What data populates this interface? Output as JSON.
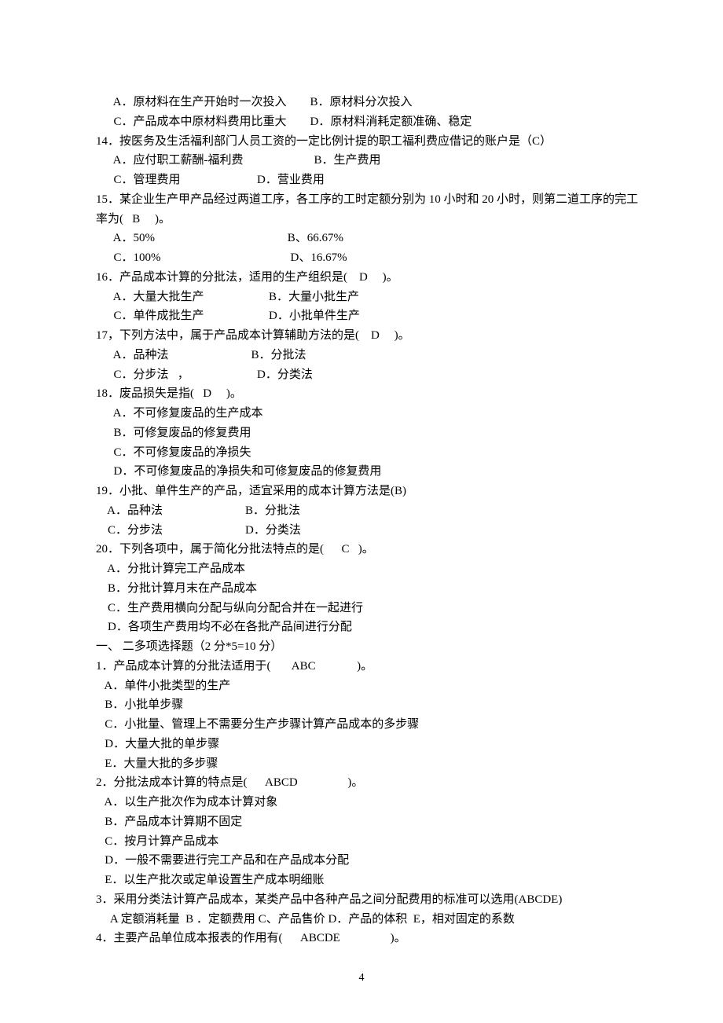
{
  "lines": [
    "      A．原材料在生产开始时一次投入        B．原材料分次投入",
    "      C．产品成本中原材料费用比重大        D．原材料消耗定额准确、稳定",
    "14．按医务及生活福利部门人员工资的一定比例计提的职工福利费应借记的账户是（C）",
    "      A．应付职工薪酬-福利费                        B．生产费用",
    "      C．管理费用                          D．营业费用",
    "15．某企业生产甲产品经过两道工序，各工序的工时定额分别为 10 小时和 20 小时，则第二道工序的完工",
    "率为(   B     )。",
    "      A．50%                                             B、66.67%",
    "      C．100%                                            D、16.67%",
    "16．产品成本计算的分批法，适用的生产组织是(    D     )。",
    "      A．大量大批生产                      B．大量小批生产",
    "      C．单件成批生产                      D．小批单件生产",
    "17，下列方法中，属于产品成本计算辅助方法的是(    D     )。",
    "      A．品种法                            B．分批法",
    "      C．分步法   ，                       D．分类法",
    "18．废品损失是指(   D     )。",
    "      A．不可修复废品的生产成本",
    "      B．可修复废品的修复费用",
    "      C．不可修复废品的净损失",
    "      D．不可修复废品的净损失和可修复废品的修复费用",
    "19．小批、单件生产的产品，适宜采用的成本计算方法是(B)",
    "    A．品种法                            B．分批法",
    "    C．分步法                            D．分类法",
    "20．下列各项中，属于简化分批法特点的是(      C   )。",
    "    A．分批计算完工产品成本",
    "    B．分批计算月末在产品成本",
    "    C．生产费用横向分配与纵向分配合并在一起进行",
    "    D．各项生产费用均不必在各批产品间进行分配",
    "一、 二多项选择题（2 分*5=10 分）",
    "1．产品成本计算的分批法适用于(       ABC              )。",
    "   A．单件小批类型的生产",
    "   B．小批单步骤",
    "   C．小批量、管理上不需要分生产步骤计算产品成本的多步骤",
    "   D．大量大批的单步骤",
    "   E．大量大批的多步骤",
    "2．分批法成本计算的特点是(      ABCD                 )。",
    "   A．以生产批次作为成本计算对象",
    "   B．产品成本计算期不固定",
    "   C．按月计算产品成本",
    "   D．一般不需要进行完工产品和在产品成本分配",
    "   E．以生产批次或定单设置生产成本明细账",
    "3．采用分类法计算产品成本，某类产品中各种产品之间分配费用的标准可以选用(ABCDE)",
    "     A 定额消耗量  B ．定额费用 C、产品售价 D．产品的体积  E，相对固定的系数",
    "4．主要产品单位成本报表的作用有(      ABCDE                 )。"
  ],
  "pageNumber": "4"
}
